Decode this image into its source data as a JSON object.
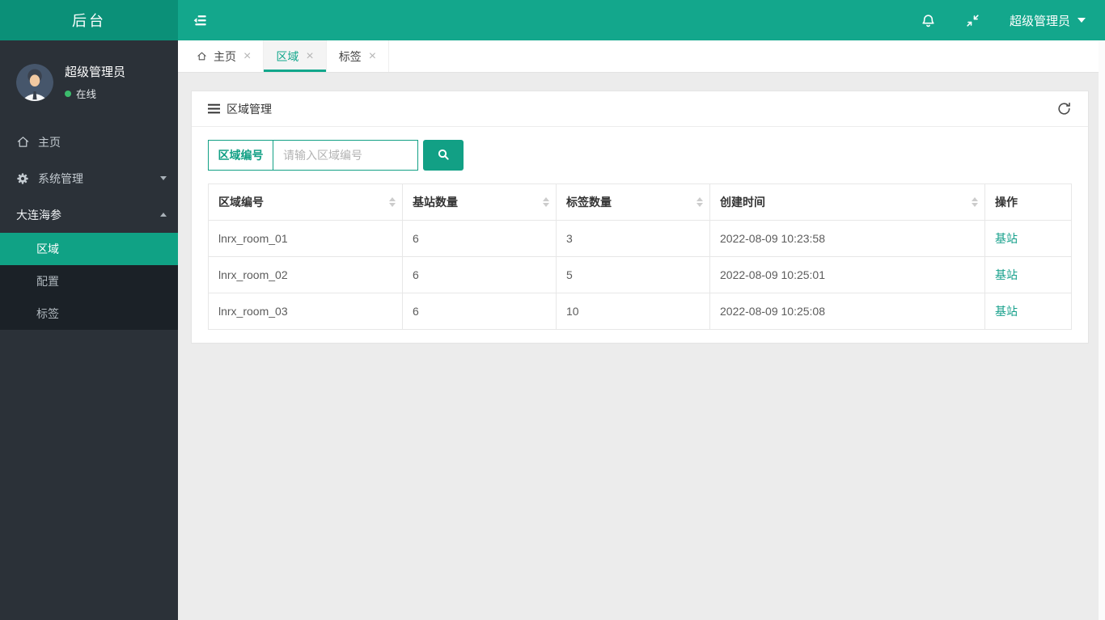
{
  "topbar": {
    "brand": "后台",
    "toggle_icon": "sidebar-toggle-icon",
    "bell_icon": "notification-bell-icon",
    "compress_icon": "fullscreen-compress-icon",
    "user_menu": {
      "label": "超级管理员",
      "caret_icon": "caret-down-icon"
    }
  },
  "sidebar": {
    "user": {
      "name": "超级管理员",
      "status": "在线",
      "avatar_icon": "user-avatar"
    },
    "menu": [
      {
        "label": "主页",
        "icon": "home-icon"
      },
      {
        "label": "系统管理",
        "icon": "gear-icon",
        "caret": "caret-down-icon"
      },
      {
        "label": "大连海参",
        "caret": "caret-up-icon"
      }
    ],
    "submenu": [
      {
        "label": "区域",
        "active": true
      },
      {
        "label": "配置",
        "active": false
      },
      {
        "label": "标签",
        "active": false
      }
    ]
  },
  "tabbar": {
    "tabs": [
      {
        "label": "主页",
        "icon": "home-icon",
        "close_icon": "close-icon",
        "active": false
      },
      {
        "label": "区域",
        "close_icon": "close-icon",
        "active": true
      },
      {
        "label": "标签",
        "close_icon": "close-icon",
        "active": false
      }
    ]
  },
  "panel": {
    "title": "区域管理",
    "title_icon": "list-menu-icon",
    "refresh_icon": "refresh-icon",
    "search": {
      "field_label": "区域编号",
      "placeholder": "请输入区域编号",
      "button_icon": "search-icon"
    },
    "table": {
      "columns": [
        {
          "label": "区域编号",
          "sortable": true
        },
        {
          "label": "基站数量",
          "sortable": true
        },
        {
          "label": "标签数量",
          "sortable": true
        },
        {
          "label": "创建时间",
          "sortable": true
        },
        {
          "label": "操作",
          "sortable": false
        }
      ],
      "rows": [
        {
          "area_id": "lnrx_room_01",
          "station_count": "6",
          "tag_count": "3",
          "created_at": "2022-08-09 10:23:58",
          "action": "基站"
        },
        {
          "area_id": "lnrx_room_02",
          "station_count": "6",
          "tag_count": "5",
          "created_at": "2022-08-09 10:25:01",
          "action": "基站"
        },
        {
          "area_id": "lnrx_room_03",
          "station_count": "6",
          "tag_count": "10",
          "created_at": "2022-08-09 10:25:08",
          "action": "基站"
        }
      ]
    }
  },
  "colors": {
    "header_teal": "#13a78c",
    "brand_teal": "#0b9078",
    "accent_teal": "#12a085",
    "sidebar_bg": "#2b3138",
    "submenu_bg": "#1b2127",
    "link_teal": "#16a08b",
    "online_green": "#3cbc6c",
    "content_bg": "#ececec"
  }
}
